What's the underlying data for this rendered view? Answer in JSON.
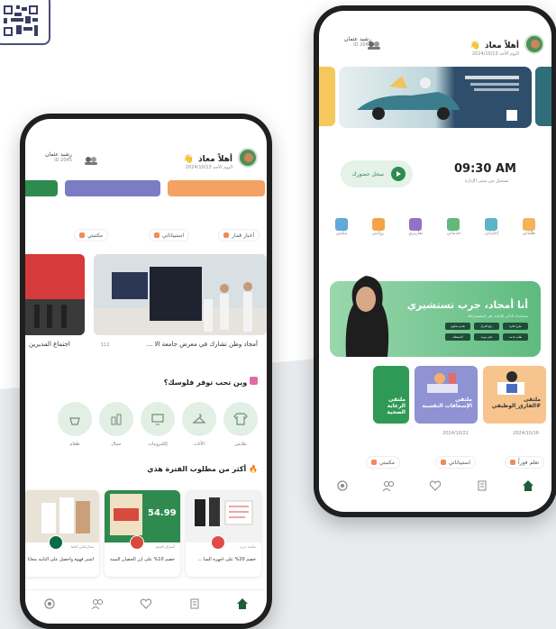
{
  "back_phone": {
    "header": {
      "user_name": "أهلاً معاذ",
      "wave": "👋",
      "date": "اليوم الأحد 2024/10/13",
      "left_name": "رشيد عثمان",
      "left_sub": "ID 2045"
    },
    "attendance": {
      "button_label": "سجل حضورك",
      "time": "09:30 AM",
      "time_sub": "تسجيل من مبنى الإدارة"
    },
    "quick_icons": [
      "طلباتي",
      "إجازاتي",
      "خدماتي",
      "تقاريري",
      "رواتبي",
      "مكتبي"
    ],
    "promo": {
      "title": "أنا أمجاد، جرب تستشيري",
      "subtitle": "مساعدك الذكي للإجابة على استفساراتك",
      "tags": [
        "طرح فكرة",
        "رفع اقتراح",
        "تقديم شكوى",
        "طلب خدمة",
        "حجز موعد",
        "الاستعلام"
      ]
    },
    "courses": [
      {
        "title_line1": "ملتقى",
        "title_line2": "#الفارق_الوظيفي",
        "meta": "2024/10/16"
      },
      {
        "title_line1": "ملتقى",
        "title_line2": "الإسعافات النفسية",
        "meta": "2024/10/22"
      },
      {
        "title_line1": "ملتقى",
        "title_line2": "الرعاية الصحية",
        "meta": ""
      }
    ],
    "chips": [
      "تعلم فوراً",
      "استبياناتي",
      "مكتبتي"
    ]
  },
  "front_phone": {
    "header": {
      "user_name": "أهلاً معاذ",
      "wave": "👋",
      "date": "اليوم الأحد 2024/10/13",
      "left_name": "رشيد عثمان",
      "left_sub": "ID 2045"
    },
    "chips": [
      "أخبار قمار",
      "استبياناتي",
      "مكتبتي"
    ],
    "news": [
      {
        "caption": "أمجاد وطن تشارك في معرض جامعة الا ...",
        "count": "112"
      },
      {
        "caption": "اجتماع المديرين",
        "count": ""
      }
    ],
    "shopping": {
      "title": "وين تحب توفر فلوسك؟",
      "categories": [
        "ملابس",
        "الأثاث",
        "إلكترونيات",
        "جمال",
        "طعام"
      ]
    },
    "deals": {
      "title": "أكثر من مطلوب الفترة هذي",
      "items": [
        {
          "store": "مكتبة جرير",
          "title": "خصم 20% على أجهزة السا ...",
          "price": ""
        },
        {
          "store": "أسواق العثيم",
          "title": "خصم 10% على أرز الحصان المبنة",
          "price": "54.99"
        },
        {
          "store": "ستاربكس العليا",
          "title": "اشتر قهوة واحصل على الثانية مجاناً",
          "price": ""
        }
      ]
    }
  },
  "nav_icons": [
    "home-icon",
    "survey-icon",
    "health-icon",
    "people-icon",
    "settings-icon"
  ],
  "colors": {
    "brand_green": "#2f8a4f",
    "promo_green": "#5dbb7f",
    "card_purple": "#7a7dc4",
    "card_orange": "#f4a263",
    "nav_home": "#1e5c3a"
  }
}
